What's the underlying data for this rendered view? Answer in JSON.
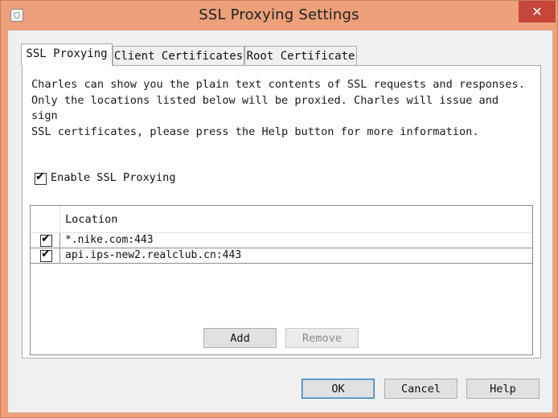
{
  "window": {
    "title": "SSL Proxying Settings",
    "close_glyph": "✕"
  },
  "tabs": [
    {
      "label": "SSL Proxying",
      "active": true
    },
    {
      "label": "Client Certificates",
      "active": false
    },
    {
      "label": "Root Certificate",
      "active": false
    }
  ],
  "panel": {
    "description": [
      "Charles can show you the plain text contents of SSL requests and responses.",
      "Only the locations listed below will be proxied. Charles will issue and sign",
      "SSL certificates, please press the Help button for more information."
    ],
    "enable_label": "Enable SSL Proxying",
    "enable_checked": true
  },
  "table": {
    "header_location": "Location",
    "rows": [
      {
        "checked": true,
        "location": "*.nike.com:443"
      },
      {
        "checked": true,
        "location": "api.ips-new2.realclub.cn:443"
      }
    ]
  },
  "actions": {
    "add_label": "Add",
    "remove_label": "Remove"
  },
  "dialog_buttons": {
    "ok_label": "OK",
    "cancel_label": "Cancel",
    "help_label": "Help"
  }
}
